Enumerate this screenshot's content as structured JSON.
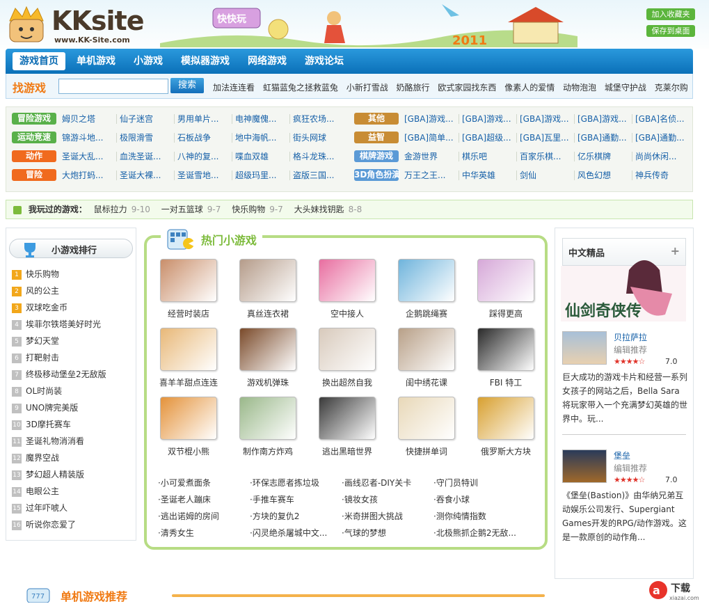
{
  "header": {
    "logo_text": "KKsite",
    "logo_url": "www.KK-Site.com",
    "banner_text": "快快玩",
    "banner_year": "2011",
    "add_favorite": "加入收藏夹",
    "save_desktop": "保存到桌面"
  },
  "nav": {
    "items": [
      "游戏首页",
      "单机游戏",
      "小游戏",
      "模拟器游戏",
      "网络游戏",
      "游戏论坛"
    ]
  },
  "search": {
    "label": "找游戏",
    "button": "搜索",
    "value": "",
    "hot": [
      "加法连连看",
      "虹猫蓝兔之拯救蓝兔",
      "小新打雪战",
      "奶酪旅行",
      "欧式家园找东西",
      "像素人的爱情",
      "动物泡泡",
      "城堡守护战",
      "克莱尔购"
    ]
  },
  "categories": {
    "left": [
      {
        "tag": "冒险游戏",
        "color": "g",
        "items": [
          "姆贝之塔",
          "仙子迷宫",
          "男用单片...",
          "电神魔傀...",
          "疯狂农场..."
        ]
      },
      {
        "tag": "运动竞速",
        "color": "g",
        "items": [
          "锦游斗地...",
          "极限滑雪",
          "石板战争",
          "地中海帆...",
          "街头网球"
        ]
      },
      {
        "tag": "动作",
        "color": "o",
        "items": [
          "圣诞大乱...",
          "血洗圣诞...",
          "八神的复...",
          "喋血双雄",
          "格斗龙珠..."
        ]
      },
      {
        "tag": "冒险",
        "color": "o",
        "items": [
          "大炮打蚂...",
          "圣诞大裸...",
          "圣诞雪地...",
          "超级玛里...",
          "盗版三国..."
        ]
      }
    ],
    "right": [
      {
        "tag": "其他",
        "color": "br",
        "items": [
          "[GBA]游戏...",
          "[GBA]游戏...",
          "[GBA]游戏...",
          "[GBA]游戏...",
          "[GBA]名侦..."
        ]
      },
      {
        "tag": "益智",
        "color": "br",
        "items": [
          "[GBA]简单...",
          "[GBA]超级...",
          "[GBA]瓦里...",
          "[GBA]通勤...",
          "[GBA]通勤..."
        ]
      },
      {
        "tag": "棋牌游戏",
        "color": "b",
        "items": [
          "金游世界",
          "棋乐吧",
          "百家乐棋...",
          "亿乐棋牌",
          "尚尚休闲..."
        ]
      },
      {
        "tag": "3D角色扮演",
        "color": "b",
        "items": [
          "万王之王...",
          "中华英雄",
          "剑仙",
          "风色幻想",
          "神兵传奇"
        ]
      }
    ]
  },
  "played": {
    "label": "我玩过的游戏：",
    "items": [
      {
        "name": "鼠标拉力",
        "time": "9-10"
      },
      {
        "name": "一对五篮球",
        "time": "9-7"
      },
      {
        "name": "快乐购物",
        "time": "9-7"
      },
      {
        "name": "大头妹找钥匙",
        "time": "8-8"
      }
    ]
  },
  "ranking": {
    "title": "小游戏排行",
    "items": [
      "快乐购物",
      "风的公主",
      "双球吃金币",
      "埃菲尔铁塔美好时光",
      "梦幻天堂",
      "打靶射击",
      "终极移动堡垒2无敌版",
      "OL时尚装",
      "UNO牌完美版",
      "3D摩托赛车",
      "圣诞礼物消消看",
      "魔界空战",
      "梦幻超人精装版",
      "电眼公主",
      "过年吓唬人",
      "听说你恋爱了"
    ]
  },
  "hot_games": {
    "title": "热门小游戏",
    "games": [
      {
        "name": "经营时装店",
        "color": "#c98e6a"
      },
      {
        "name": "真丝连衣裙",
        "color": "#b59c8a"
      },
      {
        "name": "空中接人",
        "color": "#e86ea0"
      },
      {
        "name": "企鹅跳绳赛",
        "color": "#6fb4dc"
      },
      {
        "name": "踩得更高",
        "color": "#d6a8d8"
      },
      {
        "name": "喜羊羊甜点连连",
        "color": "#e8b878"
      },
      {
        "name": "游戏机弹珠",
        "color": "#7a4a2a"
      },
      {
        "name": "换出超然自我",
        "color": "#d8cabc"
      },
      {
        "name": "闺中绣花课",
        "color": "#b8a088"
      },
      {
        "name": "FBI 特工",
        "color": "#2a2a2a"
      },
      {
        "name": "双节棍小熊",
        "color": "#e4923a"
      },
      {
        "name": "制作南方炸鸡",
        "color": "#9ab88a"
      },
      {
        "name": "逃出黑暗世界",
        "color": "#3a3a3a"
      },
      {
        "name": "快捷拼单词",
        "color": "#e8d8b8"
      },
      {
        "name": "俄罗斯大方块",
        "color": "#d8a030"
      }
    ],
    "text_links": [
      [
        "·小可爱煮面条",
        "·环保志愿者拣垃圾",
        "·画线忍者-DIY关卡",
        "·守门员特训"
      ],
      [
        "·圣诞老人蹦床",
        "·手推车赛车",
        "·镜妆女孩",
        "·吞食小球"
      ],
      [
        "·逃出诺姆的房间",
        "·方块的复仇2",
        "·米奇拼图大挑战",
        "·测你纯情指数"
      ],
      [
        "·清秀女生",
        "·闪灵绝杀屠城中文...",
        "·气球的梦想",
        "·北极熊抓企鹅2无敌..."
      ]
    ]
  },
  "featured": {
    "title": "中文精品",
    "plus": "+",
    "banner_text": "仙剑奇侠传",
    "recs": [
      {
        "name": "贝拉萨拉",
        "sub": "编辑推荐",
        "stars": "★★★★☆",
        "score": "7.0",
        "desc": "巨大成功的游戏卡片和经营一系列女孩子的网站之后，Bella Sara将玩家带入一个充满梦幻英雄的世界中。玩..."
      },
      {
        "name": "堡垒",
        "sub": "编辑推荐",
        "stars": "★★★★☆",
        "score": "7.0",
        "desc": "《堡垒(Bastion)》由华纳兄弟互动娱乐公司发行、Supergiant Games开发的RPG/动作游戏。这是一款原创的动作角..."
      }
    ]
  },
  "bottom": {
    "title": "单机游戏推荐"
  },
  "watermark": {
    "text": "下载",
    "sub": "xiazai.com"
  }
}
